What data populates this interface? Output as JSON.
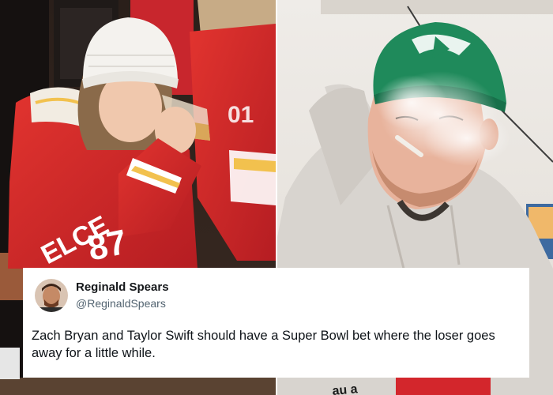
{
  "tweet": {
    "display_name": "Reginald Spears",
    "handle": "@ReginaldSpears",
    "text": "Zach Bryan and Taylor Swift should have a Super Bowl bet where the loser goes away for a little while."
  },
  "photos": {
    "left": {
      "jacket_lettering": "ELCE",
      "jersey_number": "87",
      "sleeve_number": "01"
    },
    "right": {
      "bottom_lettering": "au a"
    }
  },
  "colors": {
    "chiefs_red": "#d3262c",
    "chiefs_gold": "#f2c14e",
    "eagles_green": "#1f8a5b",
    "hoodie_gray": "#d8d4cf",
    "beanie_white": "#f4f2ee"
  }
}
